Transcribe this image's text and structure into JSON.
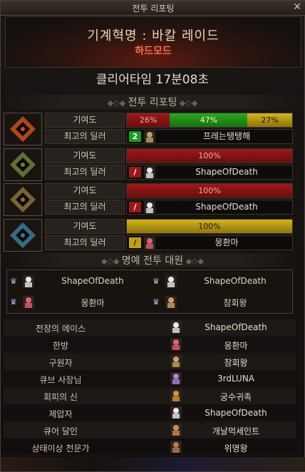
{
  "window": {
    "title": "전투 리포팅",
    "close_glyph": "✕"
  },
  "header": {
    "raid_name": "기계혁명 : 바칼 레이드",
    "mode": "하드모드"
  },
  "clear_time": "클리어타임 17분08초",
  "battle_section": {
    "title": "전투 리포팅",
    "contribution_label": "기여도",
    "best_dealer_label": "최고의 딜러"
  },
  "phases": [
    {
      "portrait_color": "#c85020",
      "contributions": [
        {
          "value": "26%",
          "fraction": 0.26,
          "color": "red"
        },
        {
          "value": "47%",
          "fraction": 0.47,
          "color": "green"
        },
        {
          "value": "27%",
          "fraction": 0.27,
          "color": "yellow"
        }
      ],
      "dealer_party": "2",
      "dealer_party_color": "g",
      "dealer_avatar": "#c0a070",
      "dealer_name": "프레는탱탱해"
    },
    {
      "portrait_color": "#6a8040",
      "contributions": [
        {
          "value": "100%",
          "fraction": 1.0,
          "color": "red"
        }
      ],
      "dealer_party": "/",
      "dealer_party_color": "r",
      "dealer_avatar": "#e8e8f0",
      "dealer_name": "ShapeOfDeath"
    },
    {
      "portrait_color": "#8a7040",
      "contributions": [
        {
          "value": "100%",
          "fraction": 1.0,
          "color": "red"
        }
      ],
      "dealer_party": "/",
      "dealer_party_color": "r",
      "dealer_avatar": "#e8e8f0",
      "dealer_name": "ShapeOfDeath"
    },
    {
      "portrait_color": "#3a7a9a",
      "contributions": [
        {
          "value": "100%",
          "fraction": 1.0,
          "color": "yellow"
        }
      ],
      "dealer_party": "/",
      "dealer_party_color": "y",
      "dealer_avatar": "#e06070",
      "dealer_name": "몽환마"
    }
  ],
  "honor_section": {
    "title": "명예 전투 대원",
    "members": [
      {
        "name": "ShapeOfDeath",
        "avatar": "#e8e8f0"
      },
      {
        "name": "ShapeOfDeath",
        "avatar": "#e8e8f0"
      },
      {
        "name": "몽환마",
        "avatar": "#e06070"
      },
      {
        "name": "참회왕",
        "avatar": "#d0a060"
      }
    ]
  },
  "awards": [
    {
      "category": "전장의 에이스",
      "name": "ShapeOfDeath",
      "avatar": "#e8e8f0"
    },
    {
      "category": "한방",
      "name": "몽환마",
      "avatar": "#e06070"
    },
    {
      "category": "구원자",
      "name": "참회왕",
      "avatar": "#d0a060"
    },
    {
      "category": "큐브 사장님",
      "name": "3rdLUNA",
      "avatar": "#b080e0"
    },
    {
      "category": "회피의 신",
      "name": "궁수귀족",
      "avatar": "#e0903a"
    },
    {
      "category": "제압자",
      "name": "ShapeOfDeath",
      "avatar": "#e8e8f0"
    },
    {
      "category": "큐어 달인",
      "name": "개날먹세인트",
      "avatar": "#d08860"
    },
    {
      "category": "상태이상 전문가",
      "name": "위명왕",
      "avatar": "#c07850"
    }
  ]
}
